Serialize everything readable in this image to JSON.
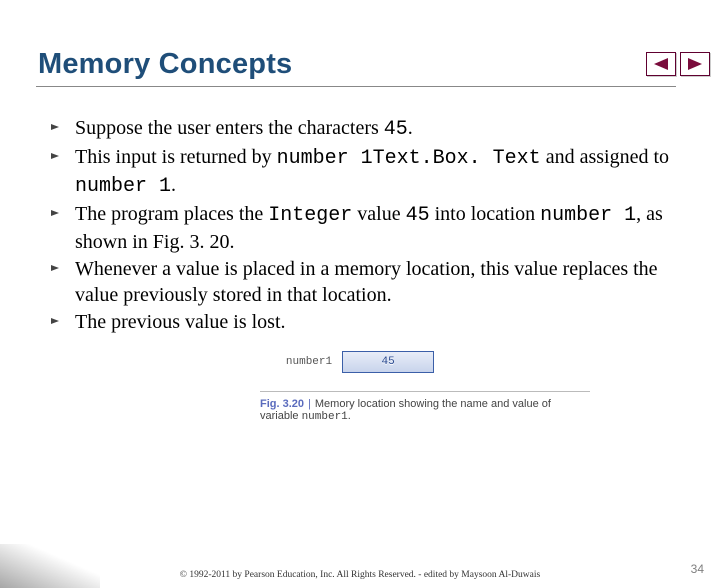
{
  "nav": {
    "prev": "prev-arrow-icon",
    "next": "next-arrow-icon"
  },
  "title": "Memory Concepts",
  "bullets": [
    {
      "pre": "Suppose the user enters the characters ",
      "code1": "45",
      "post": "."
    },
    {
      "pre": "This input is returned by ",
      "code1": "number 1Text.Box. Text",
      "mid": " and assigned to ",
      "code2": "number 1",
      "post": "."
    },
    {
      "pre": "The program places the ",
      "code1": "Integer",
      "mid": " value ",
      "code2": "45",
      "mid2": " into location ",
      "code3": "number 1",
      "post": ", as shown in Fig. 3. 20."
    },
    {
      "pre": "Whenever a value is placed in a memory location, this value replaces the value previously stored in that location.",
      "code1": "",
      "post": ""
    },
    {
      "pre": "The previous value is lost.",
      "code1": "",
      "post": ""
    }
  ],
  "figure": {
    "cell_name": "number1",
    "cell_value": "45",
    "label": "Fig. 3.20",
    "caption_a": "Memory location showing the name and value of variable ",
    "caption_code": "number1",
    "caption_b": "."
  },
  "footer": "© 1992-2011 by Pearson Education, Inc. All Rights Reserved. - edited by Maysoon Al-Duwais",
  "page": "34"
}
